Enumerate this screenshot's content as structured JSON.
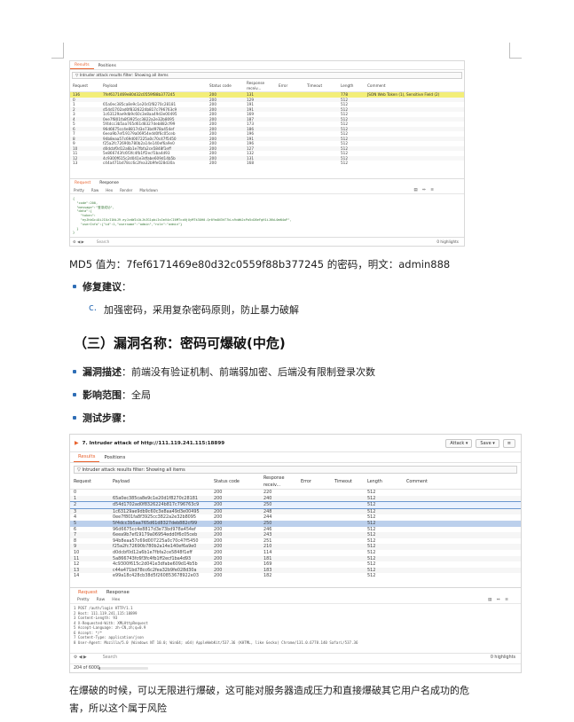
{
  "shot1": {
    "tabs": [
      "Results",
      "Positions"
    ],
    "filter": "Intruder attack results filter: Showing all items",
    "columns": [
      "Request",
      "Payload",
      "Status code",
      "Response receiv...",
      "Error",
      "Timeout",
      "Length",
      "Comment"
    ],
    "rows": [
      [
        "136",
        "7fef6171469e80d32c0559f88b377245",
        "200",
        "131",
        "",
        "",
        "778",
        "JSON Web Token (1), Sensitive Field (2)"
      ],
      [
        "0",
        "",
        "200",
        "129",
        "",
        "",
        "512",
        ""
      ],
      [
        "1",
        "65a0ec385ca8e9c1e20d1f8270c28181",
        "200",
        "191",
        "",
        "",
        "512",
        ""
      ],
      [
        "2",
        "d54d1702ad0f8326224b817c796763c9",
        "200",
        "191",
        "",
        "",
        "512",
        ""
      ],
      [
        "3",
        "1c63129ae9db9c60c3e8aa49d3e00495",
        "200",
        "169",
        "",
        "",
        "512",
        ""
      ],
      [
        "4",
        "0ee7f801fa8f3925cc3822a2e32b8095",
        "200",
        "187",
        "",
        "",
        "512",
        ""
      ],
      [
        "5",
        "5f4dcc3b5aa765d61d8327deb882cf99",
        "200",
        "173",
        "",
        "",
        "512",
        ""
      ],
      [
        "6",
        "96d6675cc4e8817d3e73bd978a454ef",
        "200",
        "186",
        "",
        "",
        "512",
        ""
      ],
      [
        "7",
        "6eea9b7ef19179a06954edd0f6c05ceb",
        "200",
        "196",
        "",
        "",
        "512",
        ""
      ],
      [
        "8",
        "94b8eaa57c69d007225a0c70c47f5450",
        "200",
        "191",
        "",
        "",
        "512",
        ""
      ],
      [
        "9",
        "f25a2fc72690b780b2a14e140ef6a9e0",
        "200",
        "196",
        "",
        "",
        "512",
        ""
      ],
      [
        "10",
        "d0dcbf0d12a6b1e7fbfa2ce5848f1eff",
        "200",
        "127",
        "",
        "",
        "512",
        ""
      ],
      [
        "11",
        "5e866743fc6f3fc4fb1ff2ecf1ba4d93",
        "200",
        "132",
        "",
        "",
        "512",
        ""
      ],
      [
        "12",
        "4c9300f615c2d041e3dfabe609d14b5b",
        "200",
        "131",
        "",
        "",
        "512",
        ""
      ],
      [
        "13",
        "c44a471bd78cc6c2fea32b9fe028d30a",
        "200",
        "168",
        "",
        "",
        "512",
        ""
      ]
    ],
    "rr_tabs": [
      "Request",
      "Response"
    ],
    "sub_tabs": [
      "Pretty",
      "Raw",
      "Hex",
      "Render",
      "Markdown"
    ],
    "icons_text": "▤ ⇔ ≡",
    "body_lines": [
      "{",
      "  \"code\":200,",
      "  \"message\":\"登录成功\",",
      "  \"data\":{",
      "    \"token\":",
      "    \"eyJhbGciOiJIUzI1NiJ9.eyJzdWIiOiJhZG1pbiIsImV4cCI6MTcxNjUyMTk3OH0.Qr0Ym4N3hT7kLs9vWb2xPa5cD8eFgH1iJ6kL0mN4oP\",",
      "    \"userInfo\":{\"id\":1,\"username\":\"admin\",\"role\":\"admin\"}",
      "  }",
      "}"
    ],
    "search_placeholder": "Search",
    "highlights": "0 highlights"
  },
  "text": {
    "md5_line": "MD5 值为：7fef6171469e80d32c0559f88b377245 的密码，明文：admin888",
    "fix_label": "修复建议",
    "fix_colon": "：",
    "fix_marker": "c.",
    "fix_text": "加强密码，采用复杂密码原则，防止暴力破解",
    "heading": "（三）漏洞名称：密码可爆破(中危)",
    "desc_label": "漏洞描述",
    "desc_text": "：前端没有验证机制、前端弱加密、后端没有限制登录次数",
    "scope_label": "影响范围",
    "scope_text": "：全局",
    "steps_label": "测试步骤：",
    "footer_line1": "在爆破的时候，可以无限进行爆破，这可能对服务器造成压力和直接爆破其它用户名成功的危",
    "footer_line2": "害，所以这个属于风险"
  },
  "shot2": {
    "title": "7. Intruder attack of http://111.119.241.115:18899",
    "attack_btn": "Attack ▾",
    "save_btn": "Save ▾",
    "menu_btn": "≡",
    "tabs": [
      "Results",
      "Positions"
    ],
    "filter": "Intruder attack results filter: Showing all items",
    "columns": [
      "Request",
      "Payload",
      "Status code",
      "Response receiv...",
      "Error",
      "Timeout",
      "Length",
      "Comment"
    ],
    "rows": [
      [
        "0",
        "",
        "200",
        "220",
        "",
        "",
        "512",
        ""
      ],
      [
        "1",
        "65a0ec385ca8e9c1e20d1f8270c28181",
        "200",
        "240",
        "",
        "",
        "512",
        ""
      ],
      [
        "2",
        "d54d1702ad0f8326224b817c796763c9",
        "200",
        "250",
        "",
        "",
        "512",
        ""
      ],
      [
        "3",
        "1c63129ae9db9c60c3e8aa49d3e00495",
        "200",
        "248",
        "",
        "",
        "512",
        ""
      ],
      [
        "4",
        "0ee7f801fa8f3925cc3822a2e32b8095",
        "200",
        "244",
        "",
        "",
        "512",
        ""
      ],
      [
        "5",
        "5f4dcc3b5aa765d61d8327deb882cf99",
        "200",
        "250",
        "",
        "",
        "512",
        ""
      ],
      [
        "6",
        "96d6675cc4e8817d3e73bd978a454ef",
        "200",
        "246",
        "",
        "",
        "512",
        ""
      ],
      [
        "7",
        "6eea9b7ef19179a06954edd0f6c05ceb",
        "200",
        "243",
        "",
        "",
        "512",
        ""
      ],
      [
        "8",
        "94b8eaa57c69d007225a0c70c47f5450",
        "200",
        "251",
        "",
        "",
        "512",
        ""
      ],
      [
        "9",
        "f25a2fc72690b780b2a14e140ef6a9e0",
        "200",
        "210",
        "",
        "",
        "512",
        ""
      ],
      [
        "10",
        "d0dcbf0d12a6b1e7fbfa2ce5848f1eff",
        "200",
        "114",
        "",
        "",
        "512",
        ""
      ],
      [
        "11",
        "5a866743fc6f3fc4fb1ff2ecf1ba4d93",
        "200",
        "181",
        "",
        "",
        "512",
        ""
      ],
      [
        "12",
        "4c9300f615c2d041e3dfabe609d14b5b",
        "200",
        "169",
        "",
        "",
        "512",
        ""
      ],
      [
        "13",
        "c44a471bd78cc6c2fea32b9fe028d30a",
        "200",
        "183",
        "",
        "",
        "512",
        ""
      ],
      [
        "14",
        "e99a18c428cb38d5f260853678922e03",
        "200",
        "182",
        "",
        "",
        "512",
        ""
      ]
    ],
    "rr_tabs": [
      "Request",
      "Response"
    ],
    "sub_tabs": [
      "Pretty",
      "Raw",
      "Hex"
    ],
    "icons_text": "▤ ⇔ ≡",
    "body_lines": [
      "1 POST /auth/login HTTP/1.1",
      "2 Host: 111.119.241.115:18899",
      "3 Content-Length: 93",
      "4 X-Requested-With: XMLHttpRequest",
      "5 Accept-Language: zh-CN,zh;q=0.9",
      "6 Accept: */*",
      "7 Content-Type: application/json",
      "8 User-Agent: Mozilla/5.0 (Windows NT 10.0; Win64; x64) AppleWebKit/537.36 (KHTML, like Gecko) Chrome/131.0.6778.140 Safari/537.36"
    ],
    "search_placeholder": "Search",
    "highlights": "0 highlights",
    "status": "204 of 6000",
    "progress": 0.034
  }
}
